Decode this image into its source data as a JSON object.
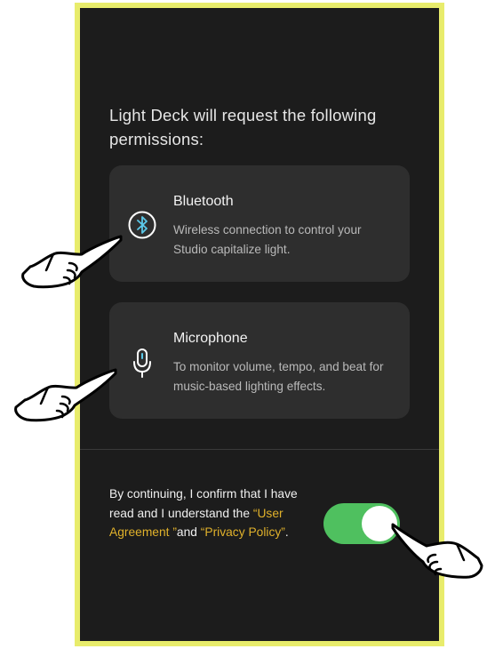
{
  "heading": "Light Deck will request the following permissions:",
  "permissions": [
    {
      "icon": "bluetooth-icon",
      "title": "Bluetooth",
      "description": "Wireless connection to control your Studio capitalize light."
    },
    {
      "icon": "microphone-icon",
      "title": "Microphone",
      "description": "To monitor volume, tempo, and beat for music-based lighting effects."
    }
  ],
  "consent": {
    "text_before": "By continuing, I confirm that I have read and I understand the ",
    "user_agreement": "“User Agreement ”",
    "middle": "and ",
    "privacy_policy": "“Privacy Policy”",
    "end": "."
  },
  "toggle": {
    "state": "on",
    "color": "#4fc05f"
  },
  "colors": {
    "frame": "#e8ec6c",
    "background": "#1c1c1c",
    "card": "#2e2e2e",
    "link": "#e0b12b"
  }
}
